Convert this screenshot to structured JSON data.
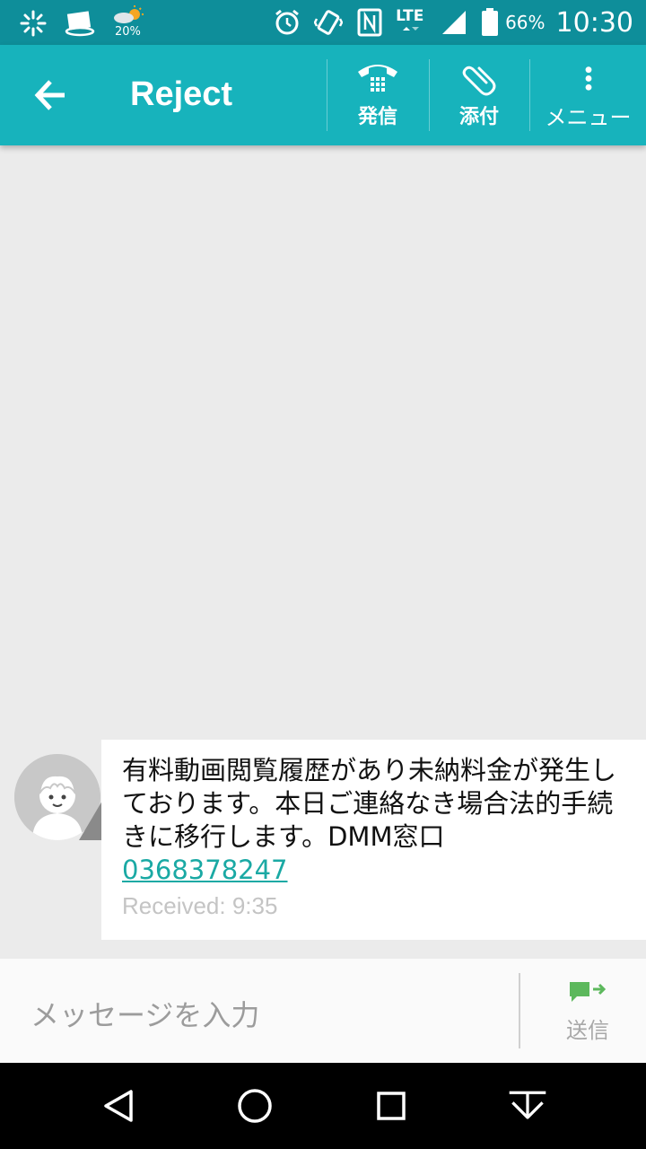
{
  "status_bar": {
    "weather_temp": "20%",
    "network": "LTE",
    "battery": "66%",
    "time": "10:30",
    "icons": [
      "loading-icon",
      "album-icon",
      "weather-icon",
      "alarm-icon",
      "vibrate-icon",
      "nfc-icon",
      "signal-icon",
      "battery-icon"
    ]
  },
  "app_bar": {
    "title": "Reject",
    "actions": {
      "call_label": "発信",
      "attach_label": "添付",
      "menu_label": "メニュー"
    }
  },
  "message": {
    "text": "有料動画閲覧履歴があり未納料金が発生しております。本日ご連絡なき場合法的手続きに移行します。DMM窓口",
    "phone": "0368378247",
    "received": "Received: 9:35"
  },
  "composer": {
    "placeholder": "メッセージを入力",
    "send_label": "送信"
  },
  "colors": {
    "accent": "#17b3bc",
    "status_bar": "#0e8e9a",
    "link": "#1aa9a4",
    "send_icon": "#5cb85c"
  }
}
